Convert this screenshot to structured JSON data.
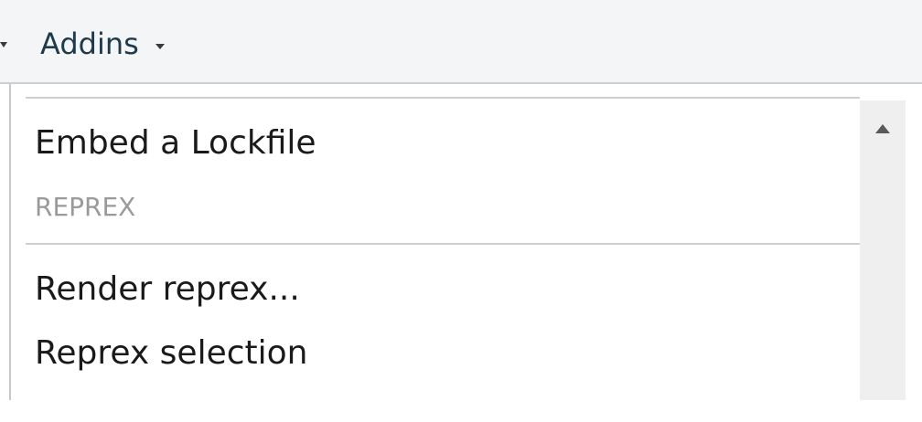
{
  "toolbar": {
    "addins_label": "Addins"
  },
  "dropdown": {
    "items": [
      {
        "label": "Embed a Lockfile"
      },
      {
        "label": "Render reprex..."
      },
      {
        "label": "Reprex selection"
      }
    ],
    "section_header": "REPREX"
  },
  "icons": {
    "left_arrow": "chevron-down-icon",
    "addins_caret": "chevron-down-icon",
    "scroll_up": "chevron-up-icon"
  },
  "colors": {
    "toolbar_bg": "#f3f5f7",
    "label_text": "#1f3a4d",
    "section_header_text": "#9a9a9a"
  }
}
